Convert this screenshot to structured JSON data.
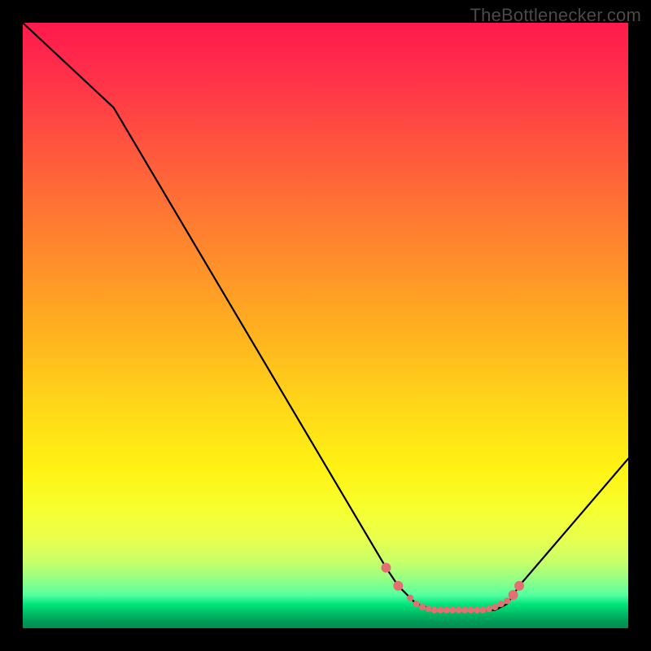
{
  "watermark": "TheBottlenecker.com",
  "chart_data": {
    "type": "line",
    "title": "",
    "xlabel": "",
    "ylabel": "",
    "xlim": [
      0,
      100
    ],
    "ylim": [
      0,
      100
    ],
    "series": [
      {
        "name": "bottleneck-curve",
        "x": [
          0,
          15,
          60,
          62,
          65,
          68,
          70,
          72,
          74,
          76,
          78,
          80,
          82,
          100
        ],
        "y": [
          100,
          86,
          10,
          7,
          4,
          3,
          3,
          3,
          3,
          3,
          3,
          4,
          7,
          28
        ]
      }
    ],
    "highlight_points": {
      "name": "flat-region-markers",
      "x": [
        60,
        62,
        64,
        65,
        66,
        67,
        68,
        69,
        70,
        71,
        72,
        73,
        74,
        75,
        76,
        77,
        78,
        79,
        80,
        81,
        82
      ],
      "y": [
        10,
        7,
        5,
        4,
        3.5,
        3.2,
        3,
        3,
        3,
        3,
        3,
        3,
        3,
        3,
        3,
        3.2,
        3.5,
        4,
        4.5,
        5.5,
        7
      ]
    },
    "background_gradient": {
      "top": "#ff1a4d",
      "mid": "#fff314",
      "bottom": "#008a4e"
    }
  }
}
